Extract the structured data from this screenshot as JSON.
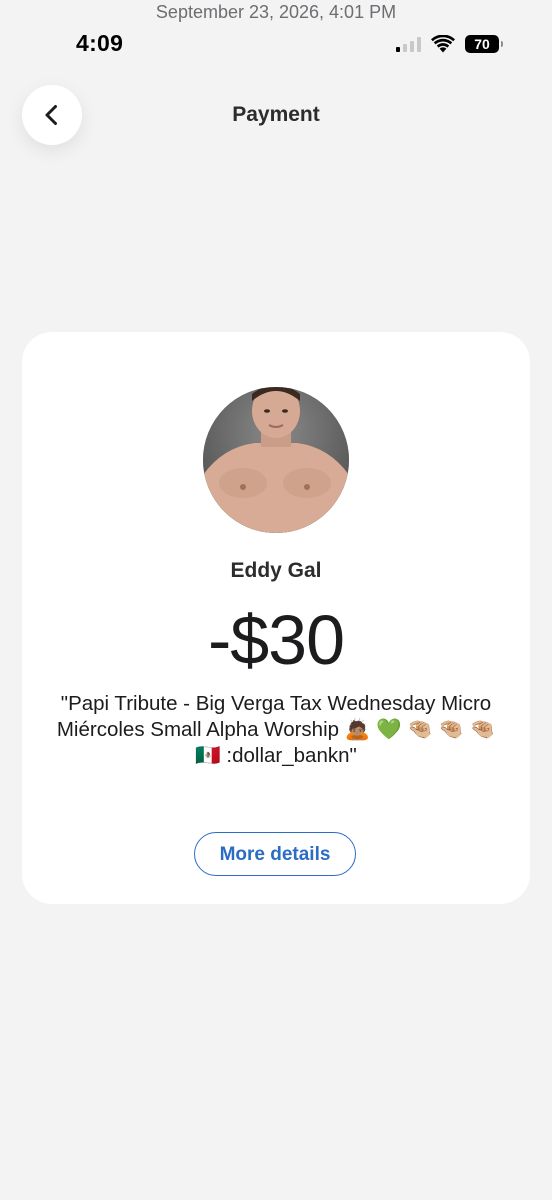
{
  "capture_timestamp": "September 23, 2026, 4:01 PM",
  "status_bar": {
    "time": "4:09",
    "battery_level": "70",
    "signal_icon": "cellular-signal-icon",
    "wifi_icon": "wifi-icon"
  },
  "header": {
    "back_icon": "chevron-left-icon",
    "title": "Payment"
  },
  "payment": {
    "payee_name": "Eddy Gal",
    "amount": "-$30",
    "memo": "\"Papi Tribute - Big Verga Tax Wednesday Micro Miércoles Small Alpha Worship 🙇🏽 💚 🤏🏼 🤏🏼 🤏🏼 🇲🇽 :dollar_bankn\"",
    "more_details_label": "More details"
  },
  "colors": {
    "background": "#f3f3f3",
    "card": "#ffffff",
    "accent": "#2b6cc4"
  }
}
